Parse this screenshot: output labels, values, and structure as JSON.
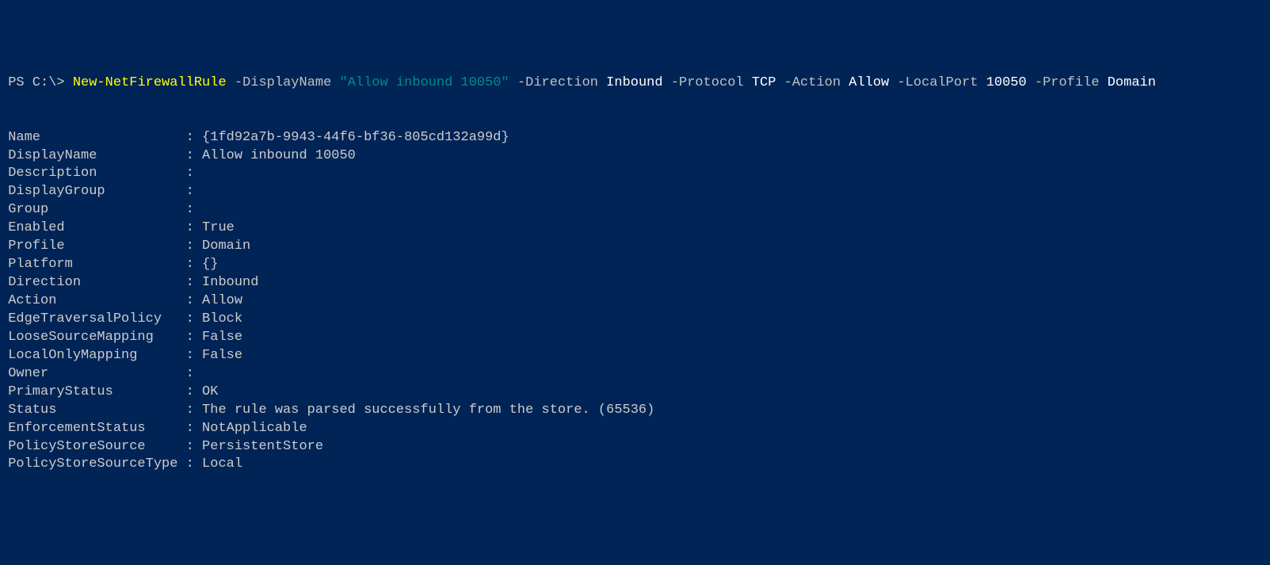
{
  "prompt": {
    "ps": " PS C:\\> ",
    "cmdlet": "New-NetFirewallRule",
    "args": [
      {
        "param": " -DisplayName ",
        "value": "\"Allow inbound 10050\"",
        "valueColor": "cmd-darkcyan"
      },
      {
        "param": " -Direction ",
        "value": "Inbound",
        "valueColor": "cmd-white"
      },
      {
        "param": " -Protocol ",
        "value": "TCP",
        "valueColor": "cmd-white"
      },
      {
        "param": " -Action ",
        "value": "Allow",
        "valueColor": "cmd-white"
      },
      {
        "param": " -LocalPort ",
        "value": "10050",
        "valueColor": "cmd-white"
      },
      {
        "param": " -Profile ",
        "value": "Domain",
        "valueColor": "cmd-white"
      }
    ]
  },
  "output": {
    "rows": [
      {
        "label": "Name",
        "value": "{1fd92a7b-9943-44f6-bf36-805cd132a99d}"
      },
      {
        "label": "DisplayName",
        "value": "Allow inbound 10050"
      },
      {
        "label": "Description",
        "value": ""
      },
      {
        "label": "DisplayGroup",
        "value": ""
      },
      {
        "label": "Group",
        "value": ""
      },
      {
        "label": "Enabled",
        "value": "True"
      },
      {
        "label": "Profile",
        "value": "Domain"
      },
      {
        "label": "Platform",
        "value": "{}"
      },
      {
        "label": "Direction",
        "value": "Inbound"
      },
      {
        "label": "Action",
        "value": "Allow"
      },
      {
        "label": "EdgeTraversalPolicy",
        "value": "Block"
      },
      {
        "label": "LooseSourceMapping",
        "value": "False"
      },
      {
        "label": "LocalOnlyMapping",
        "value": "False"
      },
      {
        "label": "Owner",
        "value": ""
      },
      {
        "label": "PrimaryStatus",
        "value": "OK"
      },
      {
        "label": "Status",
        "value": "The rule was parsed successfully from the store. (65536)"
      },
      {
        "label": "EnforcementStatus",
        "value": "NotApplicable"
      },
      {
        "label": "PolicyStoreSource",
        "value": "PersistentStore"
      },
      {
        "label": "PolicyStoreSourceType",
        "value": "Local"
      }
    ]
  }
}
